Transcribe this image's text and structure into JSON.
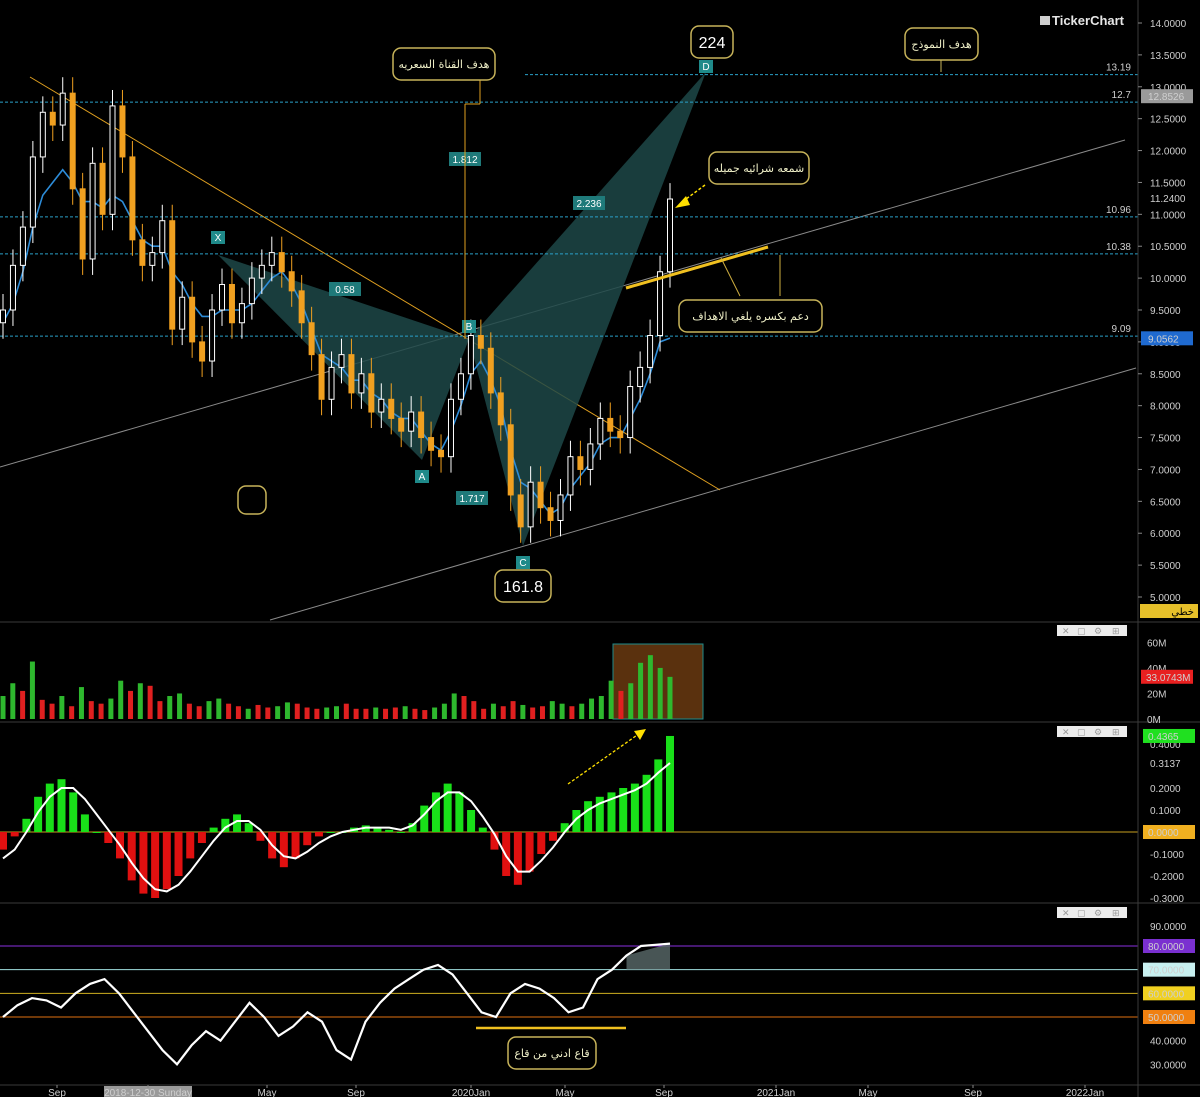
{
  "app": {
    "brand": "TickerChart",
    "chart_mode_label": "خطي"
  },
  "colors": {
    "background": "#000000",
    "up_candle": "#ffffff",
    "down_candle": "#f0a020",
    "ma_line": "#2d8cd8",
    "dashed_level": "#2aa0c8",
    "pattern_fill": "#1d4848",
    "trend_line": "#e0a020",
    "channel_line": "#8a8a8a",
    "annotation_border": "#c8b45a",
    "volume_up": "#2eb82e",
    "volume_down": "#e02020",
    "macd_up": "#19e019",
    "macd_down": "#e01010",
    "signal_line": "#ffffff",
    "rsi_line": "#ffffff",
    "arrow": "#ffe000"
  },
  "price_axis": {
    "ticks": [
      "14.0000",
      "13.5000",
      "13.0000",
      "12.5000",
      "12.0000",
      "11.5000",
      "11.0000",
      "10.5000",
      "10.0000",
      "9.5000",
      "9.0000",
      "8.5000",
      "8.0000",
      "7.5000",
      "7.0000",
      "6.5000",
      "6.0000",
      "5.5000",
      "5.0000"
    ],
    "current_price": "11.2400",
    "box_12_8526": "12.8526",
    "box_9_0562": "9.0562"
  },
  "levels": [
    {
      "label": "13.19",
      "value": 13.19
    },
    {
      "label": "12.7",
      "value": 12.76
    },
    {
      "label": "10.96",
      "value": 10.96
    },
    {
      "label": "10.38",
      "value": 10.38
    },
    {
      "label": "9.09",
      "value": 9.09
    }
  ],
  "pattern": {
    "points": [
      {
        "label": "X",
        "x": "2019-02",
        "y": 10.4
      },
      {
        "label": "A",
        "x": "2019-11",
        "y": 7.15
      },
      {
        "label": "B",
        "x": "2020-01",
        "y": 9.1
      },
      {
        "label": "C",
        "x": "2020-03",
        "y": 5.85
      },
      {
        "label": "D",
        "x": "2020-10",
        "y": 13.19
      }
    ],
    "ratios": [
      "0.58",
      "1.812",
      "1.717",
      "2.236"
    ],
    "big_labels": [
      "224",
      "161.8"
    ]
  },
  "annotations": {
    "channel_target": "هدف القناة السعريه",
    "pattern_target": "هدف النموذج",
    "nice_candle": "شمعه شرائيه جميله",
    "support_break": "دعم     بكسره يلغي الاهداف",
    "higher_low": "قاع ادني من قاع"
  },
  "volume_pane": {
    "ticks": [
      "60M",
      "40M",
      "20M",
      "0M"
    ],
    "current": "33.0743M"
  },
  "macd_pane": {
    "ticks": [
      "0.4000",
      "0.3137",
      "0.2000",
      "0.1000",
      "0.0000",
      "-0.1000",
      "-0.2000",
      "-0.3000"
    ],
    "current": "0.4365",
    "zero_label": "0.0000"
  },
  "rsi_pane": {
    "ticks": [
      "90.0000",
      "81.0271",
      "40.0000",
      "30.0000"
    ],
    "levels": [
      "80.0000",
      "70.0000",
      "60.0000",
      "50.0000"
    ],
    "current": "81.0271"
  },
  "time_axis": {
    "labels": [
      "Sep",
      "2018-12-30 Sunday",
      "May",
      "Sep",
      "2020Jan",
      "May",
      "Sep",
      "2021Jan",
      "May",
      "Sep",
      "2022Jan"
    ]
  },
  "chart_data": [
    {
      "type": "candlestick",
      "title": "",
      "y_range": [
        4.7,
        14.2
      ],
      "y_scale": "linear",
      "grid": false,
      "x_start": "2018-08",
      "x_end": "2020-10",
      "ma_label": "",
      "close_series": [
        9.5,
        10.2,
        10.8,
        11.9,
        12.6,
        12.4,
        12.9,
        11.4,
        10.3,
        11.8,
        11.0,
        12.7,
        11.9,
        10.6,
        10.2,
        10.4,
        10.9,
        9.2,
        9.7,
        9.0,
        8.7,
        9.5,
        9.9,
        9.3,
        9.6,
        10.0,
        10.2,
        10.4,
        10.1,
        9.8,
        9.3,
        8.8,
        8.1,
        8.6,
        8.8,
        8.2,
        8.5,
        7.9,
        8.1,
        7.8,
        7.6,
        7.9,
        7.5,
        7.3,
        7.2,
        8.1,
        8.5,
        9.1,
        8.9,
        8.2,
        7.7,
        6.6,
        6.1,
        6.8,
        6.4,
        6.2,
        6.6,
        7.2,
        7.0,
        7.4,
        7.8,
        7.6,
        7.5,
        8.3,
        8.6,
        9.1,
        10.1,
        11.24
      ],
      "ma_series": [
        9.3,
        9.6,
        10.1,
        10.8,
        11.3,
        11.5,
        11.7,
        11.5,
        11.2,
        11.2,
        11.1,
        11.3,
        11.2,
        10.9,
        10.6,
        10.5,
        10.5,
        10.1,
        9.9,
        9.6,
        9.4,
        9.4,
        9.5,
        9.5,
        9.5,
        9.6,
        9.8,
        10.0,
        10.1,
        9.9,
        9.6,
        9.2,
        8.8,
        8.7,
        8.6,
        8.4,
        8.4,
        8.2,
        8.1,
        7.9,
        7.8,
        7.8,
        7.6,
        7.4,
        7.3,
        7.6,
        8.0,
        8.5,
        8.7,
        8.4,
        8.0,
        7.3,
        6.8,
        6.7,
        6.5,
        6.3,
        6.4,
        6.7,
        6.9,
        7.1,
        7.4,
        7.5,
        7.5,
        7.8,
        8.1,
        8.5,
        9.0,
        9.06
      ]
    },
    {
      "type": "bar",
      "title": "",
      "y_range": [
        0,
        65
      ],
      "units": "M",
      "values": [
        18,
        28,
        22,
        45,
        15,
        12,
        18,
        10,
        25,
        14,
        12,
        16,
        30,
        22,
        28,
        26,
        14,
        18,
        20,
        12,
        10,
        14,
        16,
        12,
        10,
        8,
        11,
        9,
        10,
        13,
        12,
        9,
        8,
        9,
        10,
        12,
        8,
        8,
        9,
        8,
        9,
        10,
        8,
        7,
        9,
        12,
        20,
        18,
        14,
        8,
        12,
        10,
        14,
        11,
        9,
        10,
        14,
        12,
        10,
        12,
        16,
        18,
        30,
        22,
        28,
        44,
        50,
        40,
        33
      ],
      "colors": [
        "up",
        "up",
        "down",
        "up",
        "down",
        "down",
        "up",
        "down",
        "up",
        "down",
        "down",
        "up",
        "up",
        "down",
        "up",
        "down",
        "down",
        "up",
        "up",
        "down",
        "down",
        "up",
        "up",
        "down",
        "down",
        "up",
        "down",
        "down",
        "up",
        "up",
        "down",
        "down",
        "down",
        "up",
        "up",
        "down",
        "down",
        "down",
        "up",
        "down",
        "down",
        "up",
        "down",
        "down",
        "up",
        "up",
        "up",
        "down",
        "down",
        "down",
        "up",
        "down",
        "down",
        "up",
        "down",
        "down",
        "up",
        "up",
        "down",
        "up",
        "up",
        "up",
        "up",
        "down",
        "up",
        "up",
        "up",
        "up",
        "up"
      ]
    },
    {
      "type": "bar",
      "title": "",
      "y_range": [
        -0.33,
        0.45
      ],
      "values": [
        -0.08,
        -0.02,
        0.06,
        0.16,
        0.22,
        0.24,
        0.18,
        0.08,
        0.0,
        -0.05,
        -0.12,
        -0.22,
        -0.28,
        -0.3,
        -0.26,
        -0.2,
        -0.12,
        -0.05,
        0.02,
        0.06,
        0.08,
        0.04,
        -0.04,
        -0.12,
        -0.16,
        -0.12,
        -0.06,
        -0.02,
        0.0,
        0.0,
        0.02,
        0.03,
        0.02,
        0.01,
        0.0,
        0.04,
        0.12,
        0.18,
        0.22,
        0.18,
        0.1,
        0.02,
        -0.08,
        -0.2,
        -0.24,
        -0.18,
        -0.1,
        -0.04,
        0.04,
        0.1,
        0.14,
        0.16,
        0.18,
        0.2,
        0.22,
        0.26,
        0.33,
        0.4365
      ],
      "signal": [
        -0.12,
        -0.08,
        0.0,
        0.09,
        0.16,
        0.2,
        0.2,
        0.15,
        0.08,
        0.01,
        -0.06,
        -0.14,
        -0.21,
        -0.26,
        -0.27,
        -0.24,
        -0.18,
        -0.11,
        -0.04,
        0.02,
        0.05,
        0.05,
        0.01,
        -0.06,
        -0.11,
        -0.12,
        -0.09,
        -0.05,
        -0.02,
        0.0,
        0.01,
        0.02,
        0.02,
        0.02,
        0.01,
        0.03,
        0.08,
        0.14,
        0.18,
        0.18,
        0.14,
        0.07,
        -0.01,
        -0.11,
        -0.18,
        -0.18,
        -0.13,
        -0.07,
        0.0,
        0.06,
        0.1,
        0.13,
        0.15,
        0.17,
        0.19,
        0.22,
        0.27,
        0.3137
      ]
    },
    {
      "type": "line",
      "title": "",
      "y_range": [
        26,
        90
      ],
      "values": [
        50,
        55,
        58,
        57,
        54,
        60,
        64,
        66,
        60,
        52,
        44,
        36,
        30,
        38,
        44,
        40,
        48,
        56,
        50,
        42,
        46,
        52,
        48,
        36,
        32,
        48,
        56,
        62,
        66,
        70,
        72,
        68,
        60,
        52,
        50,
        60,
        64,
        62,
        58,
        52,
        54,
        66,
        70,
        76,
        80,
        80.5,
        81.0271
      ],
      "levels": [
        80,
        70,
        60,
        50
      ]
    }
  ]
}
